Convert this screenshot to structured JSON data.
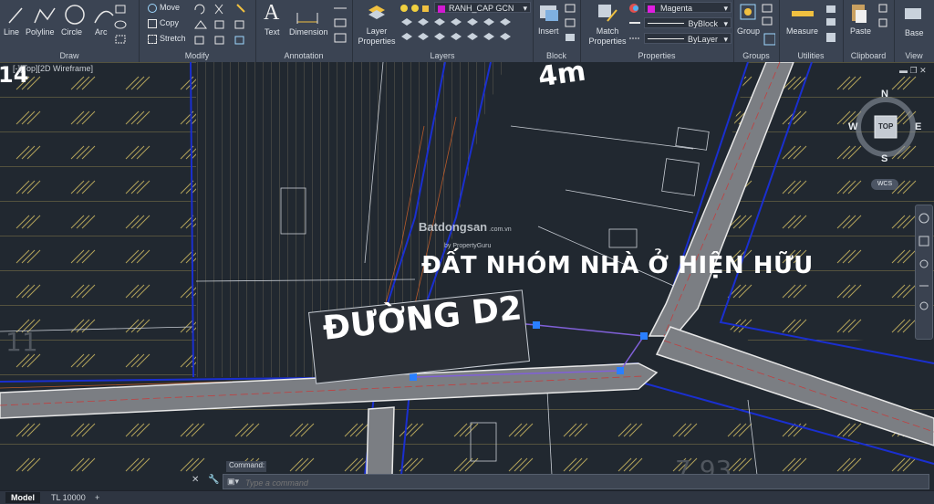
{
  "viewport_label": "[-][Top][2D Wireframe]",
  "panels": [
    {
      "title": "Draw"
    },
    {
      "title": "Modify"
    },
    {
      "title": "Annotation"
    },
    {
      "title": "Layers"
    },
    {
      "title": "Block"
    },
    {
      "title": "Properties"
    },
    {
      "title": "Groups"
    },
    {
      "title": "Utilities"
    },
    {
      "title": "Clipboard"
    },
    {
      "title": "View"
    }
  ],
  "draw_tools": [
    "Line",
    "Polyline",
    "Circle",
    "Arc"
  ],
  "modify_tools": [
    "Move",
    "Copy",
    "Stretch"
  ],
  "annotation_tools": [
    "Text",
    "Dimension"
  ],
  "layer_tool": "Layer\nProperties",
  "layer_current": "RANH_CAP GCN",
  "block_tool": "Insert",
  "match_tool": "Match\nProperties",
  "prop_color": "Magenta",
  "prop_lineweight": "ByBlock",
  "prop_linetype": "ByLayer",
  "group_tool": "Group",
  "measure_tool": "Measure",
  "paste_tool": "Paste",
  "base_tool": "Base",
  "watermark_main": "Batdongsan",
  "watermark_sub": "by PropertyGuru",
  "watermark_domain": ".com.vn",
  "compass": {
    "n": "N",
    "s": "S",
    "e": "E",
    "w": "W",
    "top": "TOP",
    "wcs": "WCS"
  },
  "drawing_text": {
    "main_label": "ĐẤT NHÓM NHÀ Ở HIỆN HỮU",
    "road_label": "ĐƯỜNG D2",
    "top_label": "4m",
    "corner_num": "14",
    "left_num": "11",
    "bottom_num": "7.93"
  },
  "command_history": "Command:",
  "command_placeholder": "Type a command",
  "layout_tabs": [
    "Model",
    "TL 10000"
  ],
  "add_tab": "+",
  "colors": {
    "layer_swatch": "#d11ad1",
    "magenta": "#e01ee0"
  }
}
